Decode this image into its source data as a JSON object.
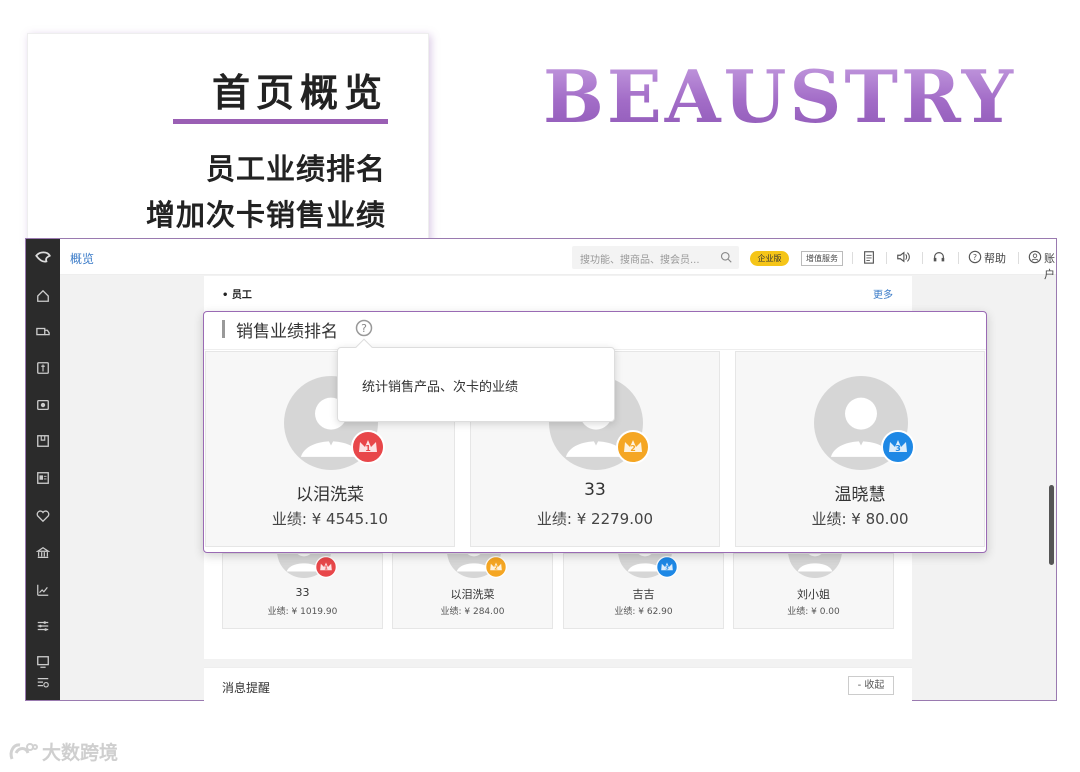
{
  "promo": {
    "title": "首页概览",
    "line1": "员工业绩排名",
    "line2": "增加次卡销售业绩"
  },
  "brand": "BEAUSTRY",
  "header": {
    "breadcrumb": "概览",
    "search_placeholder": "搜功能、搜商品、搜会员...",
    "edition_badge": "企业版",
    "value_service": "增值服务",
    "help": "帮助",
    "account": "账户"
  },
  "section": {
    "label": "• 员工",
    "more": "更多"
  },
  "popup": {
    "title": "销售业绩排名",
    "tooltip": "统计销售产品、次卡的业绩",
    "top3": [
      {
        "rank": "1",
        "name": "以泪洗菜",
        "perf": "业绩: ¥ 4545.10",
        "crown_color": "#e8474a"
      },
      {
        "rank": "2",
        "name": "33",
        "perf": "业绩: ¥ 2279.00",
        "crown_color": "#f5a623"
      },
      {
        "rank": "3",
        "name": "温晓慧",
        "perf": "业绩: ¥ 80.00",
        "crown_color": "#1e88e5"
      }
    ]
  },
  "staff_list": [
    {
      "rank": "1",
      "name": "33",
      "perf": "业绩: ¥ 1019.90",
      "crown_color": "#e8474a"
    },
    {
      "rank": "2",
      "name": "以泪洗菜",
      "perf": "业绩: ¥ 284.00",
      "crown_color": "#f5a623"
    },
    {
      "rank": "3",
      "name": "吉吉",
      "perf": "业绩: ¥ 62.90",
      "crown_color": "#1e88e5"
    },
    {
      "rank": "",
      "name": "刘小姐",
      "perf": "业绩: ¥ 0.00",
      "crown_color": ""
    }
  ],
  "messages": {
    "label": "消息提醒",
    "collapse": "- 收起"
  },
  "watermark": "大数跨境",
  "colors": {
    "accent_purple": "#9a6ab4",
    "link_blue": "#3a7bc8",
    "badge_yellow": "#f5c518",
    "sidebar_dark": "#2b2b2b"
  }
}
